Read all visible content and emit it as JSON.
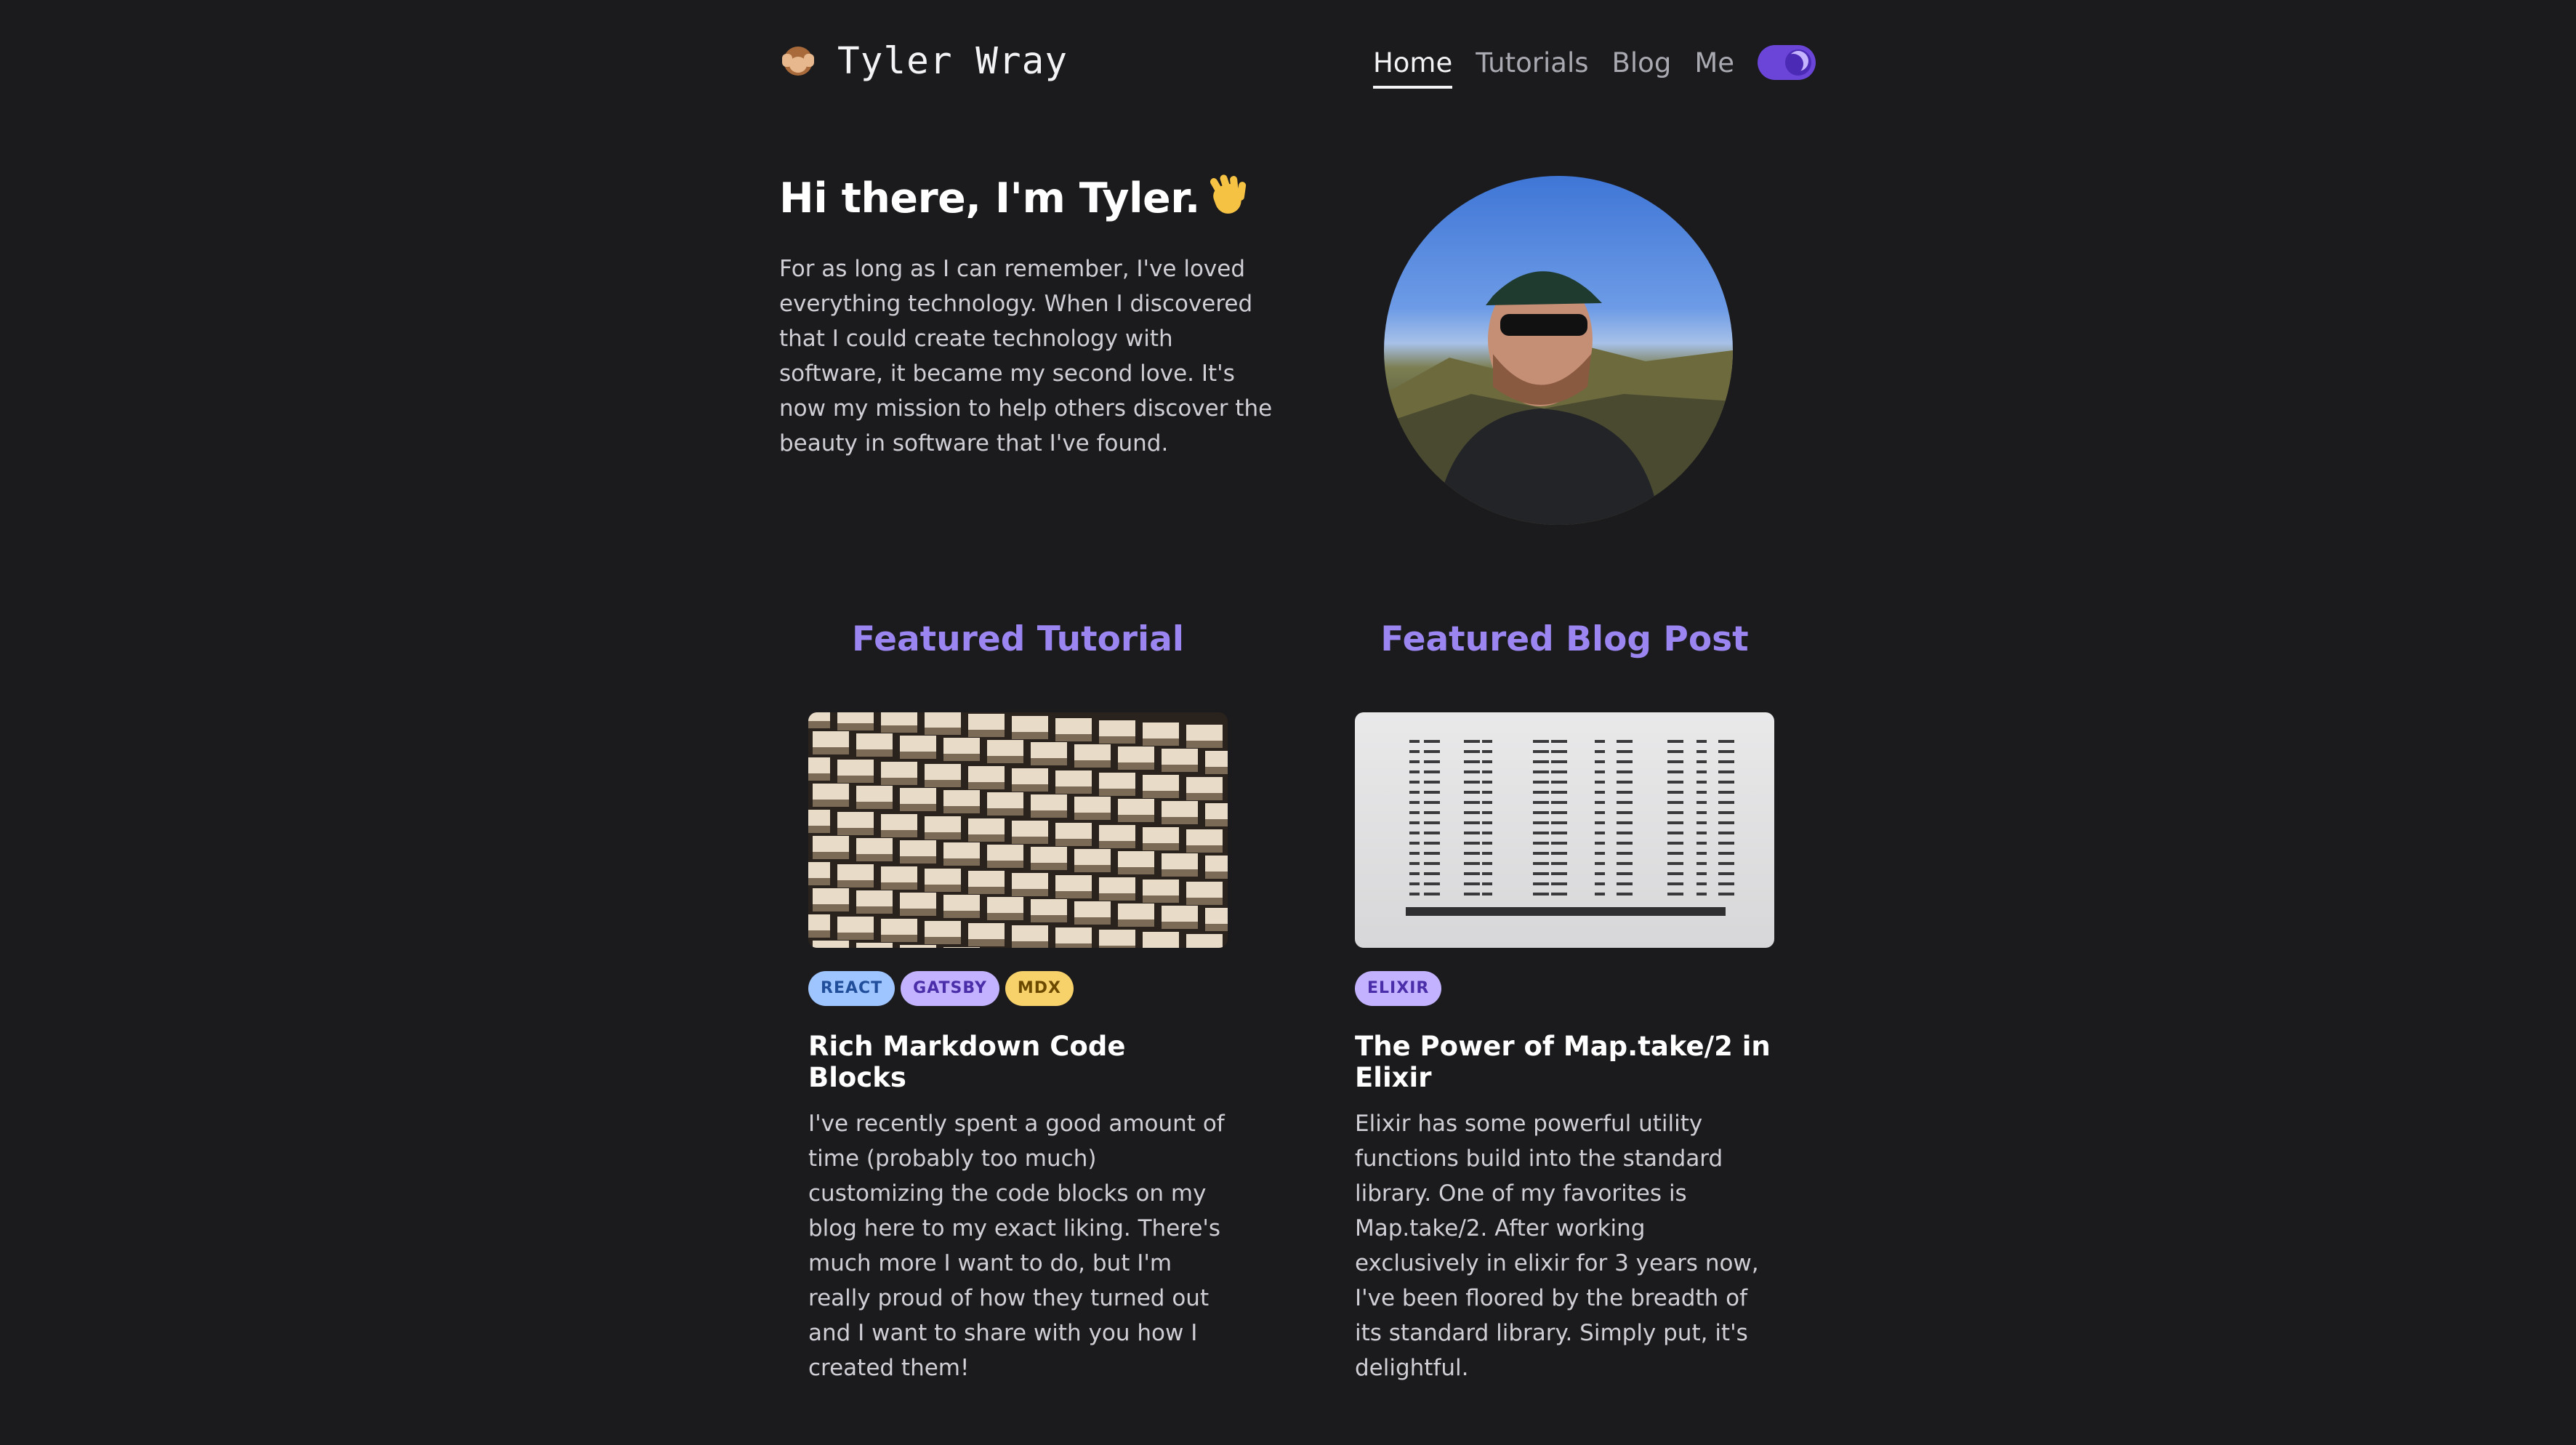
{
  "header": {
    "brand_name": "Tyler Wray",
    "brand_icon": "see-no-evil-monkey-icon",
    "nav": [
      "Home",
      "Tutorials",
      "Blog",
      "Me"
    ],
    "active_nav": "Home",
    "theme_toggle_icon": "moon-icon",
    "theme_toggle_state": "dark"
  },
  "hero": {
    "title": "Hi there, I'm Tyler.",
    "title_icon": "waving-hand-icon",
    "body": "For as long as I can remember, I've loved everything technology. When I discovered that I could create technology with software, it became my second love. It's now my mission to help others discover the beauty in software that I've found."
  },
  "featured_tutorial": {
    "heading": "Featured Tutorial",
    "tags": [
      "REACT",
      "GATSBY",
      "MDX"
    ],
    "title": "Rich Markdown Code Blocks",
    "excerpt": "I've recently spent a good amount of time (probably too much) customizing the code blocks on my blog here to my exact liking. There's much more I want to do, but I'm really proud of how they turned out and I want to share with you how I created them!"
  },
  "featured_post": {
    "heading": "Featured Blog Post",
    "tags": [
      "ELIXIR"
    ],
    "title": "The Power of Map.take/2 in Elixir",
    "excerpt": "Elixir has some powerful utility functions build into the standard library. One of my favorites is Map.take/2. After working exclusively in elixir for 3 years now, I've been floored by the breadth of its standard library. Simply put, it's delightful."
  },
  "colors": {
    "background": "#1b1b1d",
    "accent": "#9b85f0",
    "toggle": "#6a45d8"
  }
}
